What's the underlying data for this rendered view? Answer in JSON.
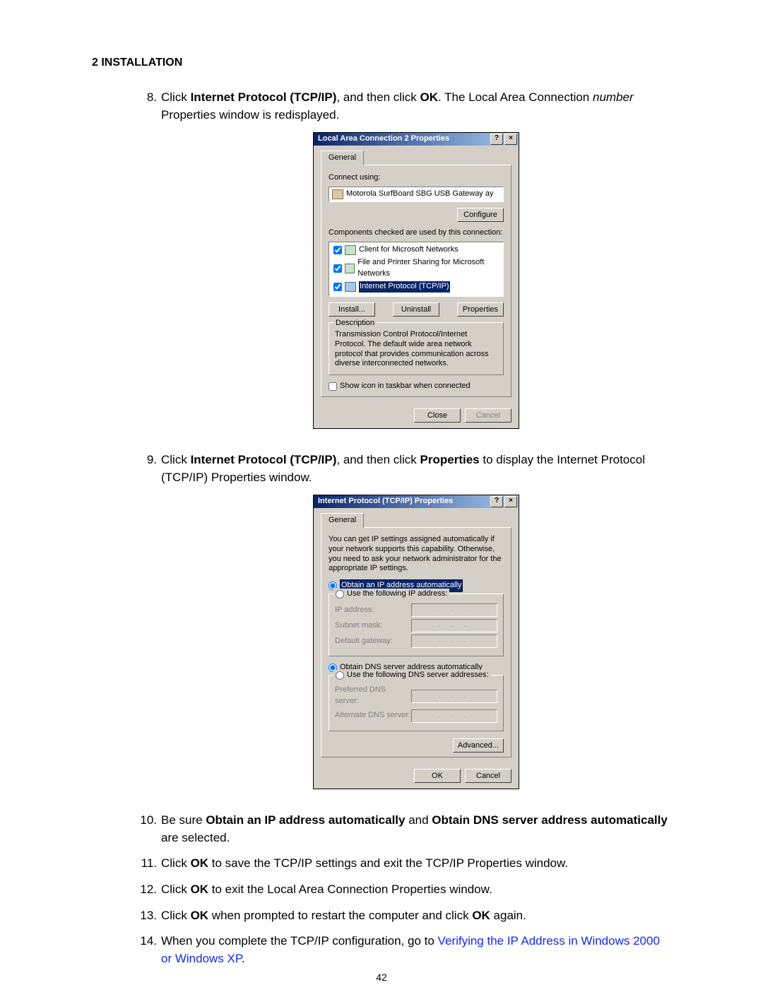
{
  "section_heading": "2 INSTALLATION",
  "page_number": "42",
  "steps": {
    "s8": {
      "num": "8.",
      "pre": "Click ",
      "b1": "Internet Protocol (TCP/IP)",
      "mid": ", and then click ",
      "b2": "OK",
      "post1_a": ". The Local Area Connection ",
      "post1_b": " Properties window is redisplayed.",
      "italic": "number"
    },
    "s9": {
      "num": "9.",
      "pre": "Click ",
      "b1": "Internet Protocol (TCP/IP)",
      "mid": ", and then click ",
      "b2": "Properties",
      "post": " to display the Internet Protocol (TCP/IP) Properties window."
    },
    "s10": {
      "num": "10.",
      "pre": "Be sure ",
      "b1": "Obtain an IP address automatically",
      "mid": " and ",
      "b2": "Obtain DNS server address automatically",
      "post": " are selected."
    },
    "s11": {
      "num": "11.",
      "pre": "Click ",
      "b1": "OK",
      "post": " to save the TCP/IP settings and exit the TCP/IP Properties window."
    },
    "s12": {
      "num": "12.",
      "pre": "Click ",
      "b1": "OK",
      "post": " to exit the Local Area Connection Properties window."
    },
    "s13": {
      "num": "13.",
      "pre": "Click ",
      "b1": "OK",
      "mid": " when prompted to restart the computer and click ",
      "b2": "OK",
      "post": " again."
    },
    "s14": {
      "num": "14.",
      "pre": "When you complete the TCP/IP configuration, go to ",
      "link": "Verifying the IP Address in Windows 2000 or Windows XP",
      "post": "."
    }
  },
  "dlg1": {
    "title": "Local Area Connection 2 Properties",
    "help_btn": "?",
    "close_btn": "×",
    "tab_general": "General",
    "connect_using_label": "Connect using:",
    "adapter": "Motorola SurfBoard SBG USB Gateway   ay",
    "configure_btn": "Configure",
    "components_label": "Components checked are used by this connection:",
    "components": [
      "Client for Microsoft Networks",
      "File and Printer Sharing for Microsoft Networks",
      "Internet Protocol (TCP/IP)"
    ],
    "install_btn": "Install...",
    "uninstall_btn": "Uninstall",
    "properties_btn": "Properties",
    "description_legend": "Description",
    "description_text": "Transmission Control Protocol/Internet Protocol. The default wide area network protocol that provides communication across diverse interconnected networks.",
    "show_icon": "Show icon in taskbar when connected",
    "close_btn2": "Close",
    "cancel_btn": "Cancel"
  },
  "dlg2": {
    "title": "Internet Protocol (TCP/IP) Properties",
    "help_btn": "?",
    "close_btn": "×",
    "tab_general": "General",
    "intro": "You can get IP settings assigned automatically if your network supports this capability. Otherwise, you need to ask your network administrator for the appropriate IP settings.",
    "r_obtain_ip": "Obtain an IP address automatically",
    "r_use_ip": "Use the following IP address:",
    "l_ip": "IP address:",
    "l_subnet": "Subnet mask:",
    "l_gateway": "Default gateway:",
    "r_obtain_dns": "Obtain DNS server address automatically",
    "r_use_dns": "Use the following DNS server addresses:",
    "l_pref_dns": "Preferred DNS server:",
    "l_alt_dns": "Alternate DNS server:",
    "advanced_btn": "Advanced...",
    "ok_btn": "OK",
    "cancel_btn": "Cancel"
  }
}
